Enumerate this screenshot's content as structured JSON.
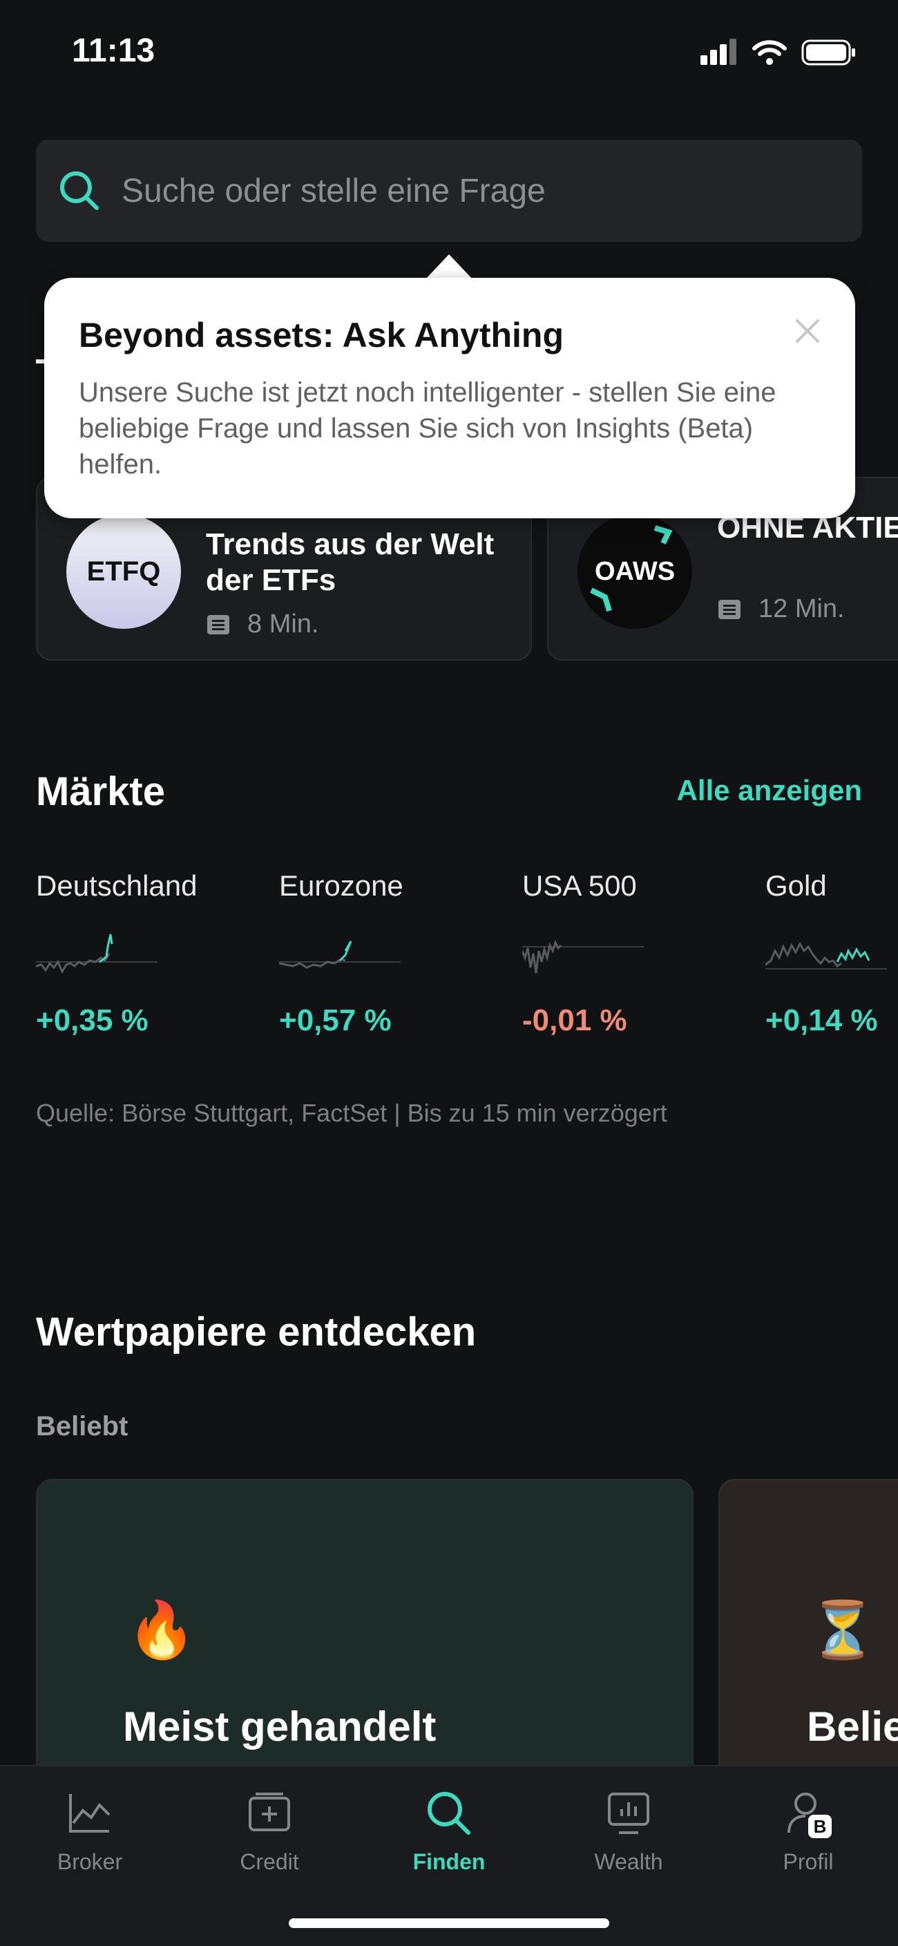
{
  "status": {
    "time": "11:13"
  },
  "search": {
    "placeholder": "Suche oder stelle eine Frage"
  },
  "tooltip": {
    "title": "Beyond assets: Ask Anything",
    "body": "Unsere Suche ist jetzt noch intelligenter - stellen Sie eine beliebige Frage und lassen Sie sich von Insights (Beta) helfen."
  },
  "podcasts": [
    {
      "logo": "ETFQ",
      "title": "Trends aus der Welt der ETFs",
      "duration": "8 Min."
    },
    {
      "logo": "OAWS",
      "title": "OHNE AKTIE SCHWER Po",
      "duration": "12 Min."
    }
  ],
  "markets": {
    "title": "Märkte",
    "see_all": "Alle anzeigen",
    "items": [
      {
        "name": "Deutschland",
        "change": "+0,35 %",
        "trend": "up"
      },
      {
        "name": "Eurozone",
        "change": "+0,57 %",
        "trend": "up"
      },
      {
        "name": "USA 500",
        "change": "-0,01 %",
        "trend": "down"
      },
      {
        "name": "Gold",
        "change": "+0,14 %",
        "trend": "up"
      }
    ],
    "source": "Quelle: Börse Stuttgart, FactSet | Bis zu 15 min verzögert"
  },
  "discover": {
    "title": "Wertpapiere entdecken",
    "subtitle": "Beliebt",
    "cards": [
      {
        "emoji": "🔥",
        "title": "Meist gehandelt"
      },
      {
        "emoji": "⏳",
        "title": "Belie"
      }
    ]
  },
  "tabs": [
    {
      "label": "Broker",
      "icon": "chart-line-icon",
      "active": false
    },
    {
      "label": "Credit",
      "icon": "credit-card-icon",
      "active": false
    },
    {
      "label": "Finden",
      "icon": "search-icon",
      "active": true
    },
    {
      "label": "Wealth",
      "icon": "wealth-chart-icon",
      "active": false
    },
    {
      "label": "Profil",
      "icon": "profile-icon",
      "active": false
    }
  ],
  "colors": {
    "accent": "#3fd9c0",
    "negative": "#ee8a78",
    "background": "#111214"
  }
}
